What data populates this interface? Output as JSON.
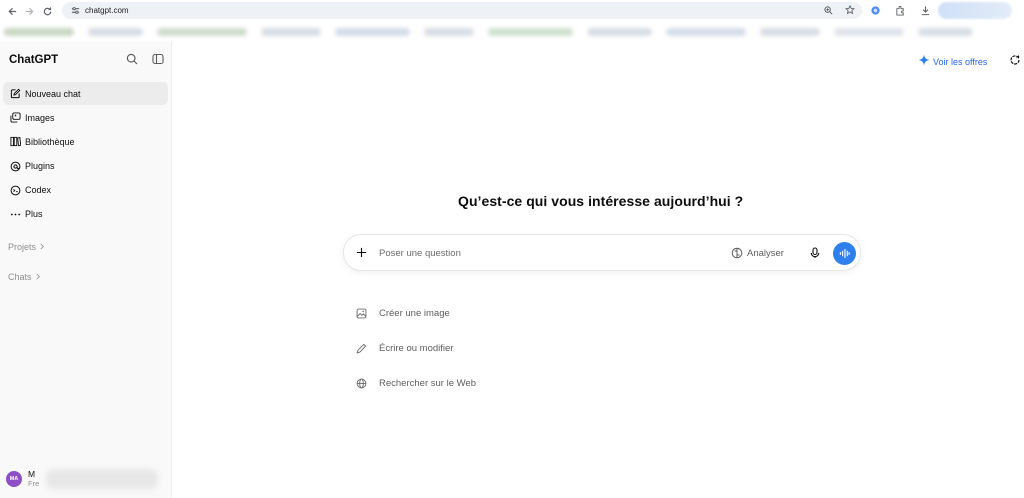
{
  "browser": {
    "url": "chatgpt.com"
  },
  "sidebar": {
    "brand": "ChatGPT",
    "items": [
      {
        "label": "Nouveau chat",
        "icon": "compose-icon"
      },
      {
        "label": "Images",
        "icon": "images-icon"
      },
      {
        "label": "Bibliothèque",
        "icon": "library-icon"
      },
      {
        "label": "Plugins",
        "icon": "plugins-icon"
      },
      {
        "label": "Codex",
        "icon": "codex-icon"
      },
      {
        "label": "Plus",
        "icon": "more-icon"
      }
    ],
    "projects_label": "Projets",
    "chats_label": "Chats",
    "user": {
      "initials": "MA",
      "name": "M",
      "plan": "Fre"
    }
  },
  "header": {
    "offers_label": "Voir les offres"
  },
  "main": {
    "headline": "Qu’est-ce qui vous intéresse aujourd’hui ?",
    "composer": {
      "placeholder": "Poser une question",
      "analyze_label": "Analyser"
    },
    "suggestions": [
      {
        "label": "Créer une image",
        "icon": "image-icon"
      },
      {
        "label": "Écrire ou modifier",
        "icon": "pencil-icon"
      },
      {
        "label": "Rechercher sur le Web",
        "icon": "globe-icon"
      }
    ]
  },
  "colors": {
    "accent": "#2f80ed",
    "link": "#2563eb",
    "avatar": "#8e4ec6",
    "sidebar_bg": "#f9f9f9"
  }
}
